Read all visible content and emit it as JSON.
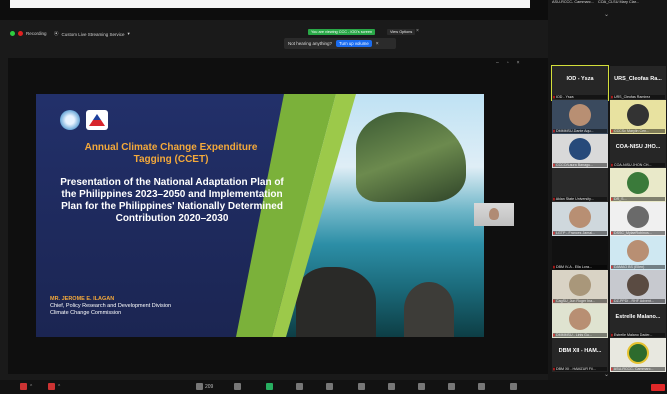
{
  "toolbar": {
    "recording_label": "Recording",
    "streaming_label": "Custom Live Streaming Service",
    "share_notice": "You are viewing CCC - IOD's screen",
    "view_options": "View Options",
    "signin": "Sign in",
    "view": "View"
  },
  "audio_hint": {
    "text": "Not hearing anything?",
    "button": "Turn up volume"
  },
  "slide": {
    "title_orange": "Annual Climate Change Expenditure Tagging (CCET)",
    "title_white": "Presentation of the National Adaptation Plan of the Philippines 2023–2050 and Implementation Plan for the Philippines' Nationally Determined Contribution 2020–2030",
    "presenter_name": "MR. JEROME E. ILAGAN",
    "presenter_title1": "Chief, Policy Research and Development Division",
    "presenter_title2": "Climate Change Commission"
  },
  "panel": {
    "top_labels": [
      "ASU-RCCC- Cammarc...",
      "COA_CLSU Mary Clar..."
    ],
    "tiles": [
      {
        "big": "IOD - Ysza",
        "label": "IOD - Ysza"
      },
      {
        "big": "URS_Cleofas Ra...",
        "label": "URS_Cleofas Ramirez"
      },
      {
        "big": "",
        "label": "DMMMSU-Dante Aqu..."
      },
      {
        "big": "",
        "label": "CCCSc Marylin Cen..."
      },
      {
        "big": "",
        "label": "CCCO/Laura Banagu..."
      },
      {
        "big": "COA-NISU JHO...",
        "label": "COA-NISU JHON CH..."
      },
      {
        "big": "",
        "label": "Aklan State University..."
      },
      {
        "big": "",
        "label": "DR_S..."
      },
      {
        "big": "",
        "label": "LGTP - Frances Jamal..."
      },
      {
        "big": "",
        "label": "DSSC_MylaeRobinos..."
      },
      {
        "big": "",
        "label": "DBM IV-A - Ella Lora..."
      },
      {
        "big": "",
        "label": "DAMAO BS (Ellen)"
      },
      {
        "big": "",
        "label": "CagSU_Jun Roger Ina..."
      },
      {
        "big": "",
        "label": "DZ-PPDI - RHF Advent..."
      },
      {
        "big": "",
        "label": "DMMMSU - Linis Gu..."
      },
      {
        "big": "Estrelle Malano...",
        "label": "Estrelle Malano Dader..."
      },
      {
        "big": "DBM XII - HAM...",
        "label": "DBM XII - HAMZUR Fil..."
      },
      {
        "big": "",
        "label": "ASU-RCCC- Cammarc..."
      }
    ]
  },
  "bottom": {
    "participants_count": "209"
  }
}
